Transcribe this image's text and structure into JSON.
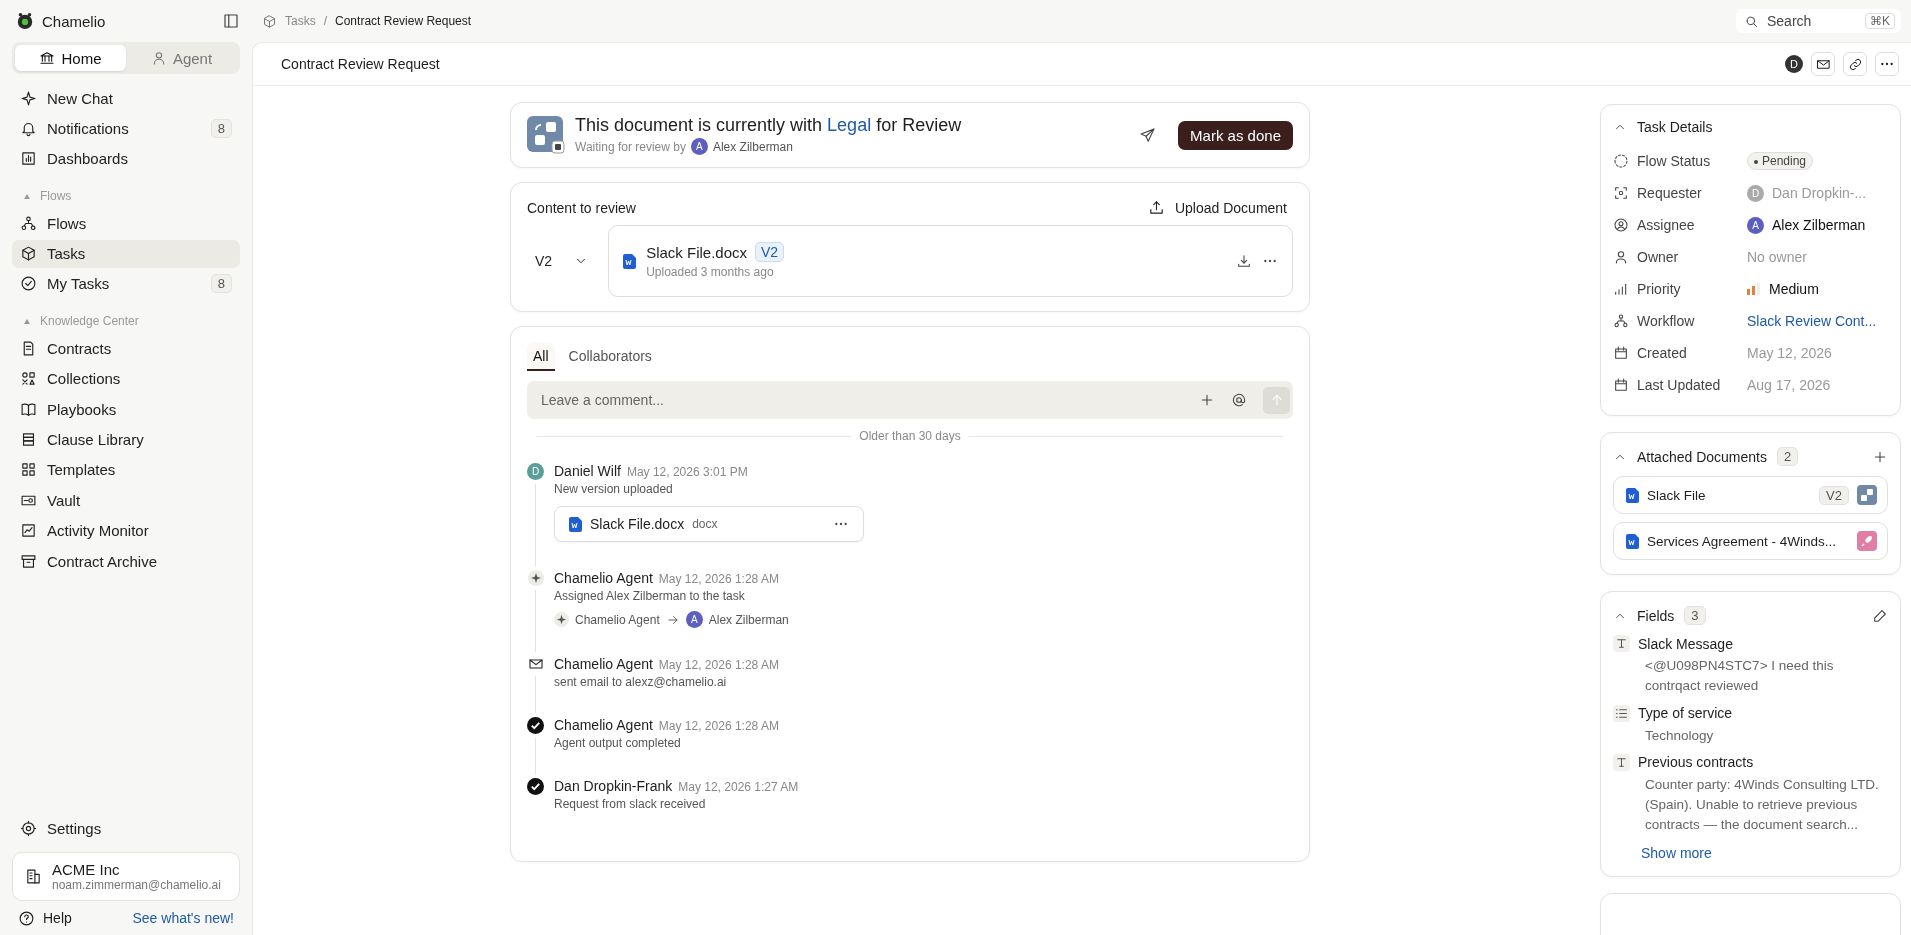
{
  "app": {
    "name": "Chamelio"
  },
  "sidebar": {
    "modes": [
      {
        "label": "Home",
        "selected": true
      },
      {
        "label": "Agent",
        "selected": false
      }
    ],
    "items": [
      {
        "kind": "item",
        "label": "New Chat",
        "selected": false
      },
      {
        "kind": "item",
        "label": "Notifications",
        "badge": "8",
        "selected": false
      },
      {
        "kind": "item",
        "label": "Dashboards",
        "selected": false
      },
      {
        "kind": "section",
        "label": "Flows"
      },
      {
        "kind": "item",
        "label": "Flows",
        "selected": false
      },
      {
        "kind": "item",
        "label": "Tasks",
        "selected": true
      },
      {
        "kind": "item",
        "label": "My Tasks",
        "badge": "8",
        "selected": false
      },
      {
        "kind": "section",
        "label": "Knowledge Center"
      },
      {
        "kind": "item",
        "label": "Contracts",
        "selected": false
      },
      {
        "kind": "item",
        "label": "Collections",
        "selected": false
      },
      {
        "kind": "item",
        "label": "Playbooks",
        "selected": false
      },
      {
        "kind": "item",
        "label": "Clause Library",
        "selected": false
      },
      {
        "kind": "item",
        "label": "Templates",
        "selected": false
      },
      {
        "kind": "item",
        "label": "Vault",
        "selected": false
      },
      {
        "kind": "item",
        "label": "Activity Monitor",
        "selected": false
      },
      {
        "kind": "item",
        "label": "Contract Archive",
        "selected": false
      }
    ],
    "settings": "Settings",
    "workspace": {
      "name": "ACME Inc",
      "email": "noam.zimmerman@chamelio.ai"
    },
    "help": "Help",
    "whats_new": "See what's new!"
  },
  "breadcrumb": [
    "Tasks",
    "Contract Review Request"
  ],
  "breadcrumb_separator": "/",
  "search": {
    "placeholder": "Search",
    "shortcut": "⌘K"
  },
  "header": {
    "title": "Contract Review Request",
    "avatar": "D"
  },
  "status_card": {
    "prefix": "This document is currently with",
    "team": "Legal",
    "suffix": "for Review",
    "waiting": "Waiting for review by",
    "reviewer_initial": "A",
    "reviewer": "Alex Zilberman",
    "button": "Mark as done"
  },
  "content": {
    "title": "Content to review",
    "upload": "Upload Document",
    "version": "V2",
    "file": {
      "name": "Slack File.docx",
      "badge": "V2",
      "meta": "Uploaded 3 months ago"
    }
  },
  "activity": {
    "tabs": [
      {
        "label": "All",
        "selected": true
      },
      {
        "label": "Collaborators",
        "selected": false
      }
    ],
    "comment_placeholder": "Leave a comment...",
    "divider": "Older than 30 days",
    "events": [
      {
        "kind": "user",
        "initial": "D",
        "color": "#5a9e98",
        "author": "Daniel Wilf",
        "time": "May 12, 2026 3:01 PM",
        "text": "New version uploaded",
        "attachment": {
          "name": "Slack File.docx",
          "ext": "docx"
        }
      },
      {
        "kind": "agent",
        "author": "Chamelio Agent",
        "time": "May 12, 2026 1:28 AM",
        "text": "Assigned Alex Zilberman to the task",
        "assignment": {
          "from": "Chamelio Agent",
          "to_initial": "A",
          "to": "Alex Zilberman"
        }
      },
      {
        "kind": "email",
        "author": "Chamelio Agent",
        "time": "May 12, 2026 1:28 AM",
        "text": "sent email to alexz@chamelio.ai"
      },
      {
        "kind": "done",
        "author": "Chamelio Agent",
        "time": "May 12, 2026 1:28 AM",
        "text": "Agent output completed"
      },
      {
        "kind": "done",
        "author": "Dan Dropkin-Frank",
        "time": "May 12, 2026 1:27 AM",
        "text": "Request from slack received"
      }
    ]
  },
  "task_details": {
    "title": "Task Details",
    "rows": [
      {
        "kind": "status",
        "label": "Flow Status",
        "value": "Pending"
      },
      {
        "kind": "person",
        "label": "Requester",
        "initial": "D",
        "value": "Dan Dropkin-...",
        "disabled": true
      },
      {
        "kind": "person",
        "label": "Assignee",
        "initial": "A",
        "value": "Alex Zilberman",
        "disabled": false
      },
      {
        "kind": "muted",
        "label": "Owner",
        "value": "No owner"
      },
      {
        "kind": "priority",
        "label": "Priority",
        "value": "Medium"
      },
      {
        "kind": "link",
        "label": "Workflow",
        "value": "Slack Review Cont..."
      },
      {
        "kind": "muted",
        "label": "Created",
        "value": "May 12, 2026"
      },
      {
        "kind": "muted",
        "label": "Last Updated",
        "value": "Aug 17, 2026"
      }
    ]
  },
  "attached": {
    "title": "Attached Documents",
    "count": "2",
    "docs": [
      {
        "name": "Slack File",
        "version": "V2",
        "kind": "shapes"
      },
      {
        "name": "Services Agreement - 4Winds...",
        "kind": "rocket"
      }
    ]
  },
  "fields": {
    "title": "Fields",
    "count": "3",
    "items": [
      {
        "kind": "text",
        "label": "Slack Message",
        "value": "<@U098PN4STC7> I need this contrqact reviewed"
      },
      {
        "kind": "list",
        "label": "Type of service",
        "value": "Technology"
      },
      {
        "kind": "text",
        "label": "Previous contracts",
        "value": "Counter party: 4Winds Consulting LTD. (Spain). Unable to retrieve previous contracts — the document search..."
      }
    ],
    "show_more": "Show more"
  }
}
